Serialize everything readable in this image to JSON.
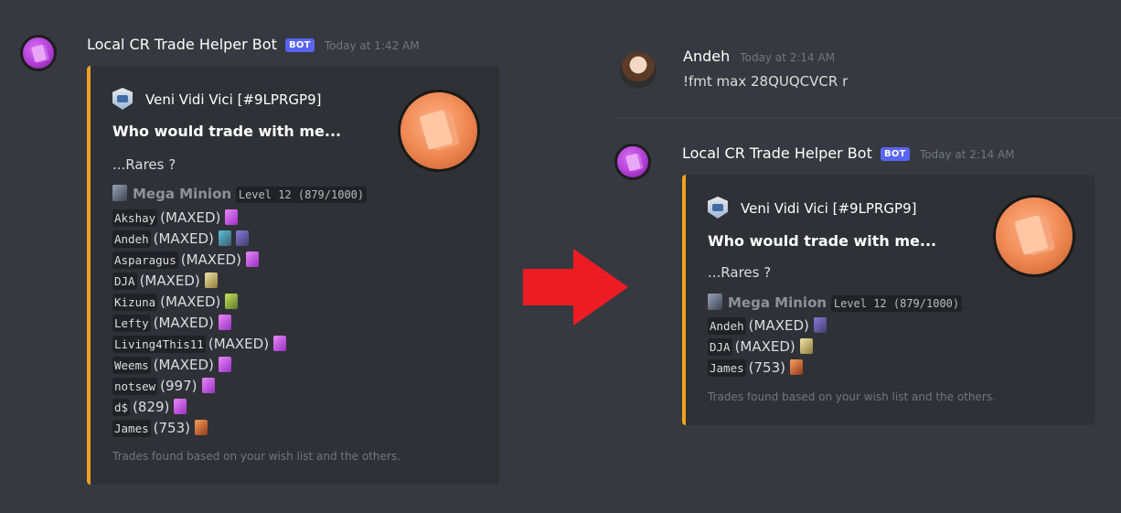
{
  "left_message": {
    "author": "Local CR Trade Helper Bot",
    "bot_tag": "BOT",
    "timestamp": "Today at 1:42 AM",
    "embed": {
      "author": "Veni Vidi Vici [#9LPRGP9]",
      "title": "Who would trade with me...",
      "description": "...Rares ?",
      "card_name": "Mega Minion",
      "card_level": "Level 12 (879/1000)",
      "rows": [
        {
          "name": "Akshay",
          "status": "(MAXED)"
        },
        {
          "name": "Andeh",
          "status": "(MAXED)"
        },
        {
          "name": "Asparagus",
          "status": "(MAXED)"
        },
        {
          "name": "DJA",
          "status": "(MAXED)"
        },
        {
          "name": "Kizuna",
          "status": "(MAXED)"
        },
        {
          "name": "Lefty",
          "status": "(MAXED)"
        },
        {
          "name": "Living4This11",
          "status": "(MAXED)"
        },
        {
          "name": "Weems",
          "status": "(MAXED)"
        },
        {
          "name": "notsew",
          "status": "(997)"
        },
        {
          "name": "d$",
          "status": "(829)"
        },
        {
          "name": "James",
          "status": "(753)"
        }
      ],
      "footer": "Trades found based on your wish list and the others."
    }
  },
  "user_message": {
    "author": "Andeh",
    "timestamp": "Today at 2:14 AM",
    "content": "!fmt max 28QUQCVCR r"
  },
  "right_message": {
    "author": "Local CR Trade Helper Bot",
    "bot_tag": "BOT",
    "timestamp": "Today at 2:14 AM",
    "embed": {
      "author": "Veni Vidi Vici [#9LPRGP9]",
      "title": "Who would trade with me...",
      "description": "...Rares ?",
      "card_name": "Mega Minion",
      "card_level": "Level 12 (879/1000)",
      "rows": [
        {
          "name": "Andeh",
          "status": "(MAXED)"
        },
        {
          "name": "DJA",
          "status": "(MAXED)"
        },
        {
          "name": "James",
          "status": "(753)"
        }
      ],
      "footer": "Trades found based on your wish list and the others."
    }
  },
  "colors": {
    "background": "#36393f",
    "embed_bg": "#2f3136",
    "embed_accent": "#f0a020",
    "bot_tag": "#5865f2",
    "arrow": "#ed1c24"
  }
}
